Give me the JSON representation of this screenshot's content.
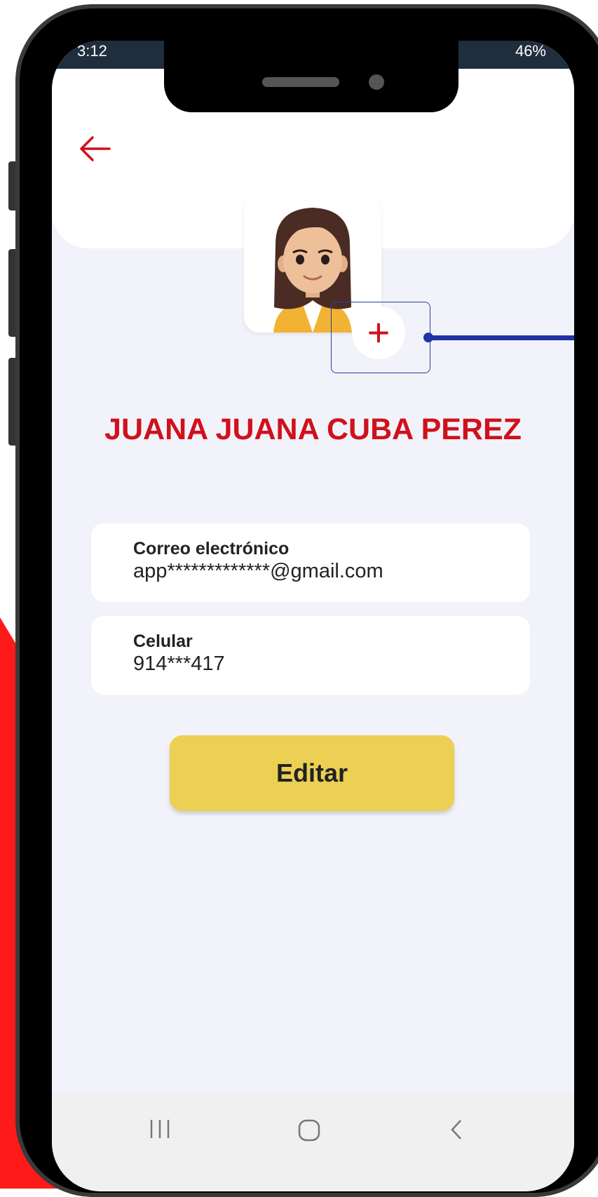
{
  "status_bar": {
    "time": "3:12",
    "battery": "46%"
  },
  "header": {
    "back_icon": "arrow-left-icon"
  },
  "profile": {
    "avatar_icon": "avatar-icon",
    "add_photo_label": "+",
    "name": "JUANA JUANA CUBA PEREZ"
  },
  "fields": {
    "email": {
      "label": "Correo electrónico",
      "value": "app*************@gmail.com"
    },
    "phone": {
      "label": "Celular",
      "value": "914***417"
    }
  },
  "actions": {
    "edit_label": "Editar"
  },
  "nav": {
    "recents_icon": "recents-icon",
    "home_icon": "home-icon",
    "back_icon": "back-chevron-icon"
  },
  "colors": {
    "accent_red": "#d0111c",
    "button_yellow": "#ecd053",
    "annotation_blue": "#2233a8",
    "background": "#f2f3fa"
  }
}
